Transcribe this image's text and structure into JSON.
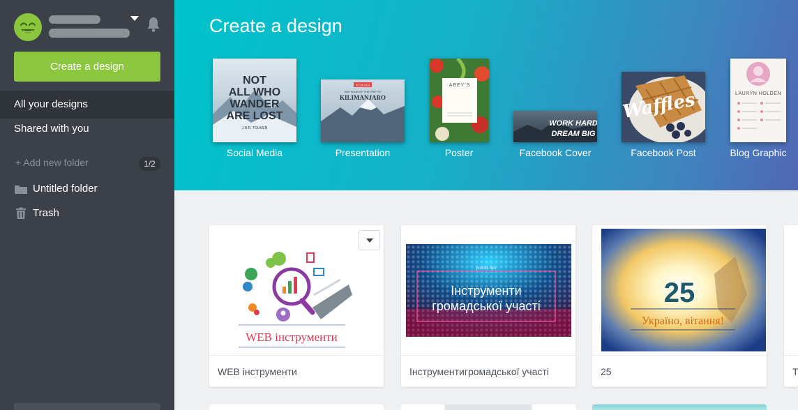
{
  "sidebar": {
    "create_button": "Create a design",
    "nav": [
      {
        "label": "All your designs",
        "active": true
      },
      {
        "label": "Shared with you",
        "active": false
      }
    ],
    "add_folder": "+ Add new folder",
    "folder_count": "1/2",
    "folders": [
      {
        "label": "Untitled folder",
        "icon": "folder-icon"
      },
      {
        "label": "Trash",
        "icon": "trash-icon"
      }
    ]
  },
  "hero": {
    "title": "Create a design",
    "types": [
      {
        "label": "Social Media",
        "thumb_text": "NOT ALL WHO WANDER ARE LOST",
        "thumb_sub": "J.R.R. TOLKIEN"
      },
      {
        "label": "Presentation",
        "thumb_text": "KILIMANJARO",
        "thumb_sub": "DAY FOUR OF THE TRIP TO",
        "thumb_date": "05.28.2014"
      },
      {
        "label": "Poster",
        "thumb_text": "ABEY'S"
      },
      {
        "label": "Facebook Cover",
        "thumb_text": "WORK HARD DREAM BIG"
      },
      {
        "label": "Facebook Post",
        "thumb_text": "Waffles"
      },
      {
        "label": "Blog Graphic",
        "thumb_text": "LAURYN HOLDEN"
      }
    ]
  },
  "designs": [
    {
      "caption": "WEB інструменти",
      "thumb_text": "WEB інструменти"
    },
    {
      "caption": "Інструментигромадської участі",
      "thumb_text_1": "Інструменти",
      "thumb_text_2": "громадської участі",
      "thumb_small": "practic tips"
    },
    {
      "caption": "25",
      "thumb_number": "25",
      "thumb_text": "Україно, вітання!"
    },
    {
      "caption": "T"
    }
  ],
  "colors": {
    "sidebar": "#3b4049",
    "sidebar_active": "#30343b",
    "accent_green": "#8cc63f",
    "hero_start": "#00c4cc",
    "hero_end": "#5267b4"
  }
}
